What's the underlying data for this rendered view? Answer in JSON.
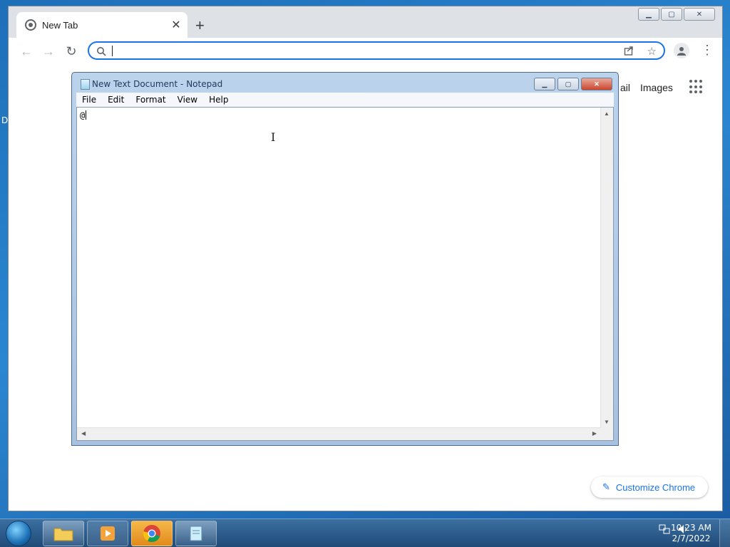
{
  "desktop": {
    "fragment": "D"
  },
  "chrome": {
    "tab": {
      "title": "New Tab"
    },
    "omnibox": {
      "value": ""
    },
    "links": {
      "gmail": "ail",
      "images": "Images"
    },
    "customize": "Customize Chrome"
  },
  "notepad": {
    "title": "New Text Document - Notepad",
    "menu": {
      "file": "File",
      "edit": "Edit",
      "format": "Format",
      "view": "View",
      "help": "Help"
    },
    "text": "@"
  },
  "taskbar": {
    "time": "10:23 AM",
    "date": "2/7/2022"
  },
  "colors": {
    "accent": "#1a73e8",
    "taskbar": "#1f4a78",
    "desktop": "#2b86d1"
  }
}
